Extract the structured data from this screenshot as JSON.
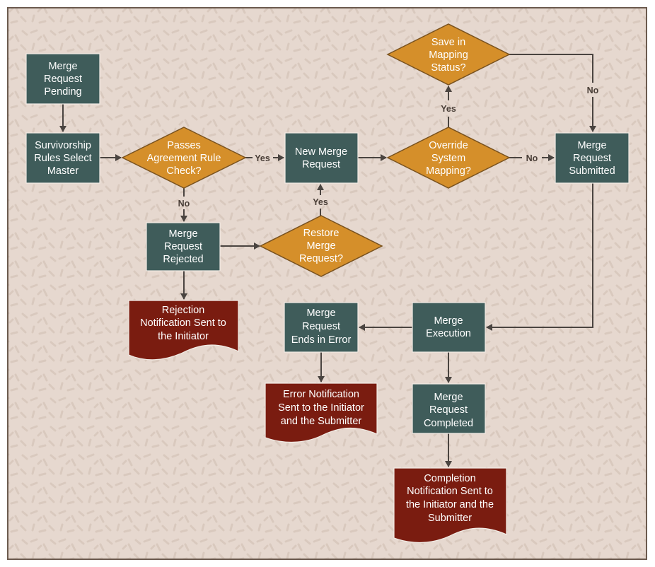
{
  "colors": {
    "background": "#e6d8cf",
    "frame": "#6b5a4e",
    "process": "#3f5c5a",
    "decision": "#d58f2a",
    "document": "#7a1c10",
    "connector": "#4a4440"
  },
  "nodes": {
    "pending": {
      "lines": [
        "Merge",
        "Request",
        "Pending"
      ]
    },
    "survivorship": {
      "lines": [
        "Survivorship",
        "Rules Select",
        "Master"
      ]
    },
    "passes": {
      "lines": [
        "Passes",
        "Agreement Rule",
        "Check?"
      ]
    },
    "new_merge": {
      "lines": [
        "New Merge",
        "Request"
      ]
    },
    "override": {
      "lines": [
        "Override",
        "System",
        "Mapping?"
      ]
    },
    "save_mapping": {
      "lines": [
        "Save in",
        "Mapping",
        "Status?"
      ]
    },
    "submitted": {
      "lines": [
        "Merge",
        "Request",
        "Submitted"
      ]
    },
    "rejected": {
      "lines": [
        "Merge",
        "Request",
        "Rejected"
      ]
    },
    "restore": {
      "lines": [
        "Restore",
        "Merge",
        "Request?"
      ]
    },
    "rejection_notice": {
      "lines": [
        "Rejection",
        "Notification Sent to",
        "the Initiator"
      ]
    },
    "execution": {
      "lines": [
        "Merge",
        "Execution"
      ]
    },
    "ends_error": {
      "lines": [
        "Merge",
        "Request",
        "Ends in Error"
      ]
    },
    "error_notice": {
      "lines": [
        "Error Notification",
        "Sent to the Initiator",
        "and the Submitter"
      ]
    },
    "completed": {
      "lines": [
        "Merge",
        "Request",
        "Completed"
      ]
    },
    "completion_notice": {
      "lines": [
        "Completion",
        "Notification Sent to",
        "the Initiator and the",
        "Submitter"
      ]
    }
  },
  "edge_labels": {
    "passes_yes": "Yes",
    "passes_no": "No",
    "override_yes": "Yes",
    "override_no": "No",
    "save_no": "No",
    "restore_yes": "Yes"
  }
}
